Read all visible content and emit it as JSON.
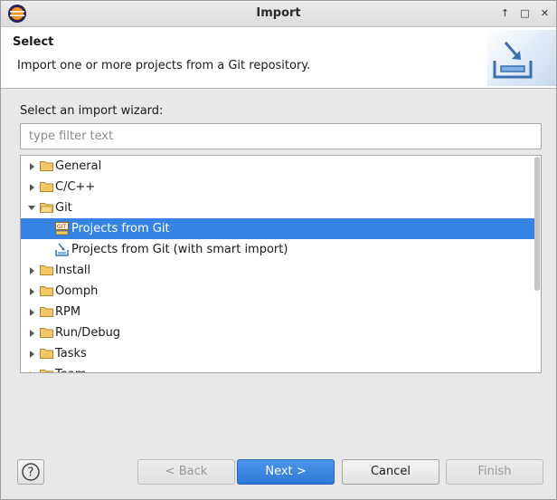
{
  "window": {
    "title": "Import"
  },
  "banner": {
    "title": "Select",
    "description": "Import one or more projects from a Git repository."
  },
  "wizard": {
    "label": "Select an import wizard:",
    "filter_placeholder": "type filter text",
    "filter_value": ""
  },
  "tree": {
    "items": [
      {
        "label": "General",
        "expanded": false
      },
      {
        "label": "C/C++",
        "expanded": false
      },
      {
        "label": "Git",
        "expanded": true
      },
      {
        "label": "Projects from Git",
        "child": true,
        "selected": true
      },
      {
        "label": "Projects from Git (with smart import)",
        "child": true
      },
      {
        "label": "Install",
        "expanded": false
      },
      {
        "label": "Oomph",
        "expanded": false
      },
      {
        "label": "RPM",
        "expanded": false
      },
      {
        "label": "Run/Debug",
        "expanded": false
      },
      {
        "label": "Tasks",
        "expanded": false
      },
      {
        "label": "Team",
        "expanded": false
      }
    ]
  },
  "buttons": {
    "help": "?",
    "back": "< Back",
    "next": "Next >",
    "cancel": "Cancel",
    "finish": "Finish"
  },
  "colors": {
    "selection": "#3584e4",
    "folder": "#e8b84a",
    "primary_button": "#3584e4"
  },
  "icons": {
    "app": "eclipse-icon",
    "folder": "folder-icon",
    "git_project": "git-repository-icon",
    "smart_import": "smart-import-icon",
    "banner": "import-wizard-icon"
  }
}
